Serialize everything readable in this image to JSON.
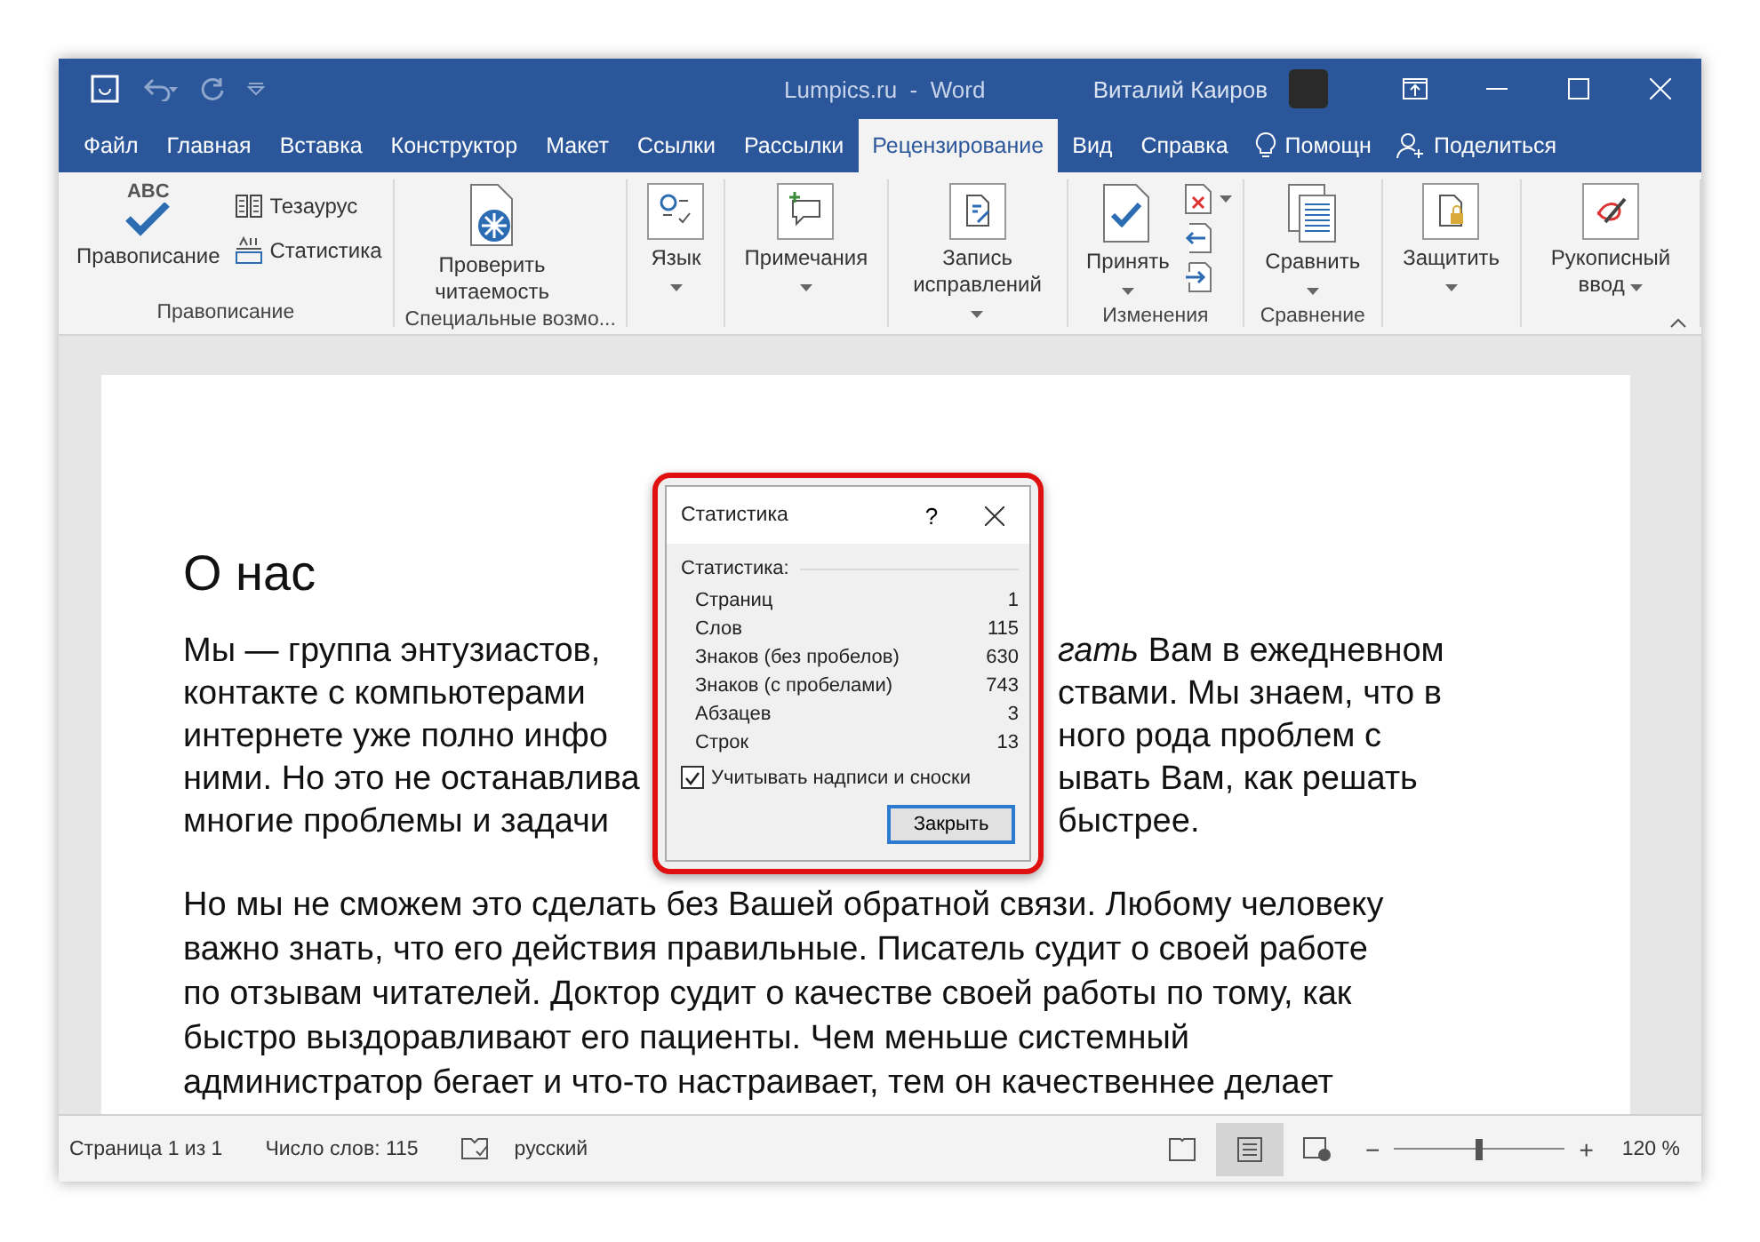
{
  "window": {
    "title": "Lumpics.ru  -  Word",
    "user": "Виталий Каиров"
  },
  "tabs": [
    {
      "label": "Файл",
      "selected": false
    },
    {
      "label": "Главная",
      "selected": false
    },
    {
      "label": "Вставка",
      "selected": false
    },
    {
      "label": "Конструктор",
      "selected": false
    },
    {
      "label": "Макет",
      "selected": false
    },
    {
      "label": "Ссылки",
      "selected": false
    },
    {
      "label": "Рассылки",
      "selected": false
    },
    {
      "label": "Рецензирование",
      "selected": true
    },
    {
      "label": "Вид",
      "selected": false
    },
    {
      "label": "Справка",
      "selected": false
    }
  ],
  "tell_me": "Помощн",
  "share": "Поделиться",
  "ribbon": {
    "groups": [
      {
        "label": "Правописание",
        "items": [
          {
            "kind": "large",
            "label": "Правописание",
            "icon_text": "ABC",
            "dropdown": false
          },
          {
            "kind": "small",
            "label": "Тезаурус",
            "dropdown": false
          },
          {
            "kind": "small",
            "label": "Статистика",
            "dropdown": false
          }
        ]
      },
      {
        "label": "Специальные возмо...",
        "items": [
          {
            "kind": "large",
            "label": "Проверить читаемость",
            "dropdown": false
          }
        ]
      },
      {
        "items": [
          {
            "kind": "large",
            "label": "Язык",
            "dropdown": true
          }
        ]
      },
      {
        "items": [
          {
            "kind": "large",
            "label": "Примечания",
            "dropdown": true
          }
        ]
      },
      {
        "items": [
          {
            "kind": "large",
            "label": "Запись исправлений",
            "dropdown": true
          }
        ]
      },
      {
        "label": "Изменения",
        "items": [
          {
            "kind": "large",
            "label": "Принять",
            "dropdown": true
          },
          {
            "kind": "icon",
            "dropdown": true
          },
          {
            "kind": "icon",
            "dropdown": false
          },
          {
            "kind": "icon",
            "dropdown": false
          }
        ]
      },
      {
        "label": "Сравнение",
        "items": [
          {
            "kind": "large",
            "label": "Сравнить",
            "dropdown": true
          }
        ]
      },
      {
        "items": [
          {
            "kind": "large",
            "label": "Защитить",
            "dropdown": true
          }
        ]
      },
      {
        "items": [
          {
            "kind": "large",
            "label": "Рукописный ввод",
            "dropdown": true
          }
        ]
      }
    ]
  },
  "document": {
    "heading": "О нас",
    "paragraph_1_lines": [
      {
        "left": "Мы — группа энтузиастов,",
        "right": "*гать* Вам в ежедневном"
      },
      {
        "left": "контакте с компьютерами",
        "right": "ствами. Мы знаем, что в"
      },
      {
        "left": "интернете уже полно инфо",
        "right": "ного рода проблем с"
      },
      {
        "left": "ними. Но это не останавлива",
        "right": "ывать Вам, как решать"
      },
      {
        "left": "многие проблемы и задачи",
        "right": "быстрее."
      }
    ],
    "paragraph_2_lines": [
      "Но мы не сможем это сделать без Вашей обратной связи. Любому человеку",
      "важно знать, что его действия правильные. Писатель судит о своей работе",
      "по отзывам читателей. Доктор судит о качестве своей работы по тому, как",
      "быстро выздоравливают его пациенты. Чем меньше системный",
      "администратор бегает и что-то настраивает, тем он качественнее делает"
    ]
  },
  "dialog": {
    "title": "Статистика",
    "help": "?",
    "section": "Статистика:",
    "rows": [
      {
        "label": "Страниц",
        "value": "1"
      },
      {
        "label": "Слов",
        "value": "115"
      },
      {
        "label": "Знаков (без пробелов)",
        "value": "630"
      },
      {
        "label": "Знаков (с пробелами)",
        "value": "743"
      },
      {
        "label": "Абзацев",
        "value": "3"
      },
      {
        "label": "Строк",
        "value": "13"
      }
    ],
    "checkbox": {
      "label": "Учитывать надписи и сноски",
      "checked": true
    },
    "button": "Закрыть"
  },
  "status_bar": {
    "page": "Страница 1 из 1",
    "words": "Число слов: 115",
    "language": "русский",
    "zoom": {
      "out": "−",
      "in": "+",
      "level": 0.5,
      "reading": "120 %"
    }
  }
}
